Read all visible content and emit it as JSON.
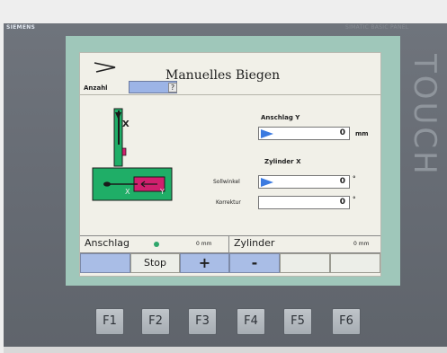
{
  "device": {
    "brand": "SIEMENS",
    "model": "SIMATIC BASIC PANEL",
    "side_label": "TOUCH"
  },
  "screen": {
    "title": "Manuelles Biegen",
    "anzahl": {
      "label": "Anzahl",
      "value": "",
      "button": "?"
    },
    "machine_labels": {
      "axis_x": "X",
      "axis_y": "Y"
    },
    "anschlag_y": {
      "label": "Anschlag Y",
      "value": "0",
      "unit": "mm"
    },
    "zylinder_x": {
      "label": "Zylinder X",
      "sollwinkel": {
        "label": "Sollwinkel",
        "value": "0",
        "unit": "°"
      },
      "korrektur": {
        "label": "Korrektur",
        "value": "0",
        "unit": "°"
      }
    },
    "status": [
      {
        "name": "Anschlag",
        "value": "0 mm",
        "led_color": "#2fa66b"
      },
      {
        "name": "Zylinder",
        "value": "0 mm"
      }
    ],
    "buttons": [
      "",
      "Stop",
      "+",
      "-",
      "",
      ""
    ]
  },
  "function_keys": [
    "F1",
    "F2",
    "F3",
    "F4",
    "F5",
    "F6"
  ],
  "colors": {
    "frame": "#9fc7ba",
    "machine_green": "#1fae67",
    "machine_magenta": "#d0206e",
    "indicator_blue": "#3b7ae0",
    "button_blue": "#a9bde6"
  }
}
